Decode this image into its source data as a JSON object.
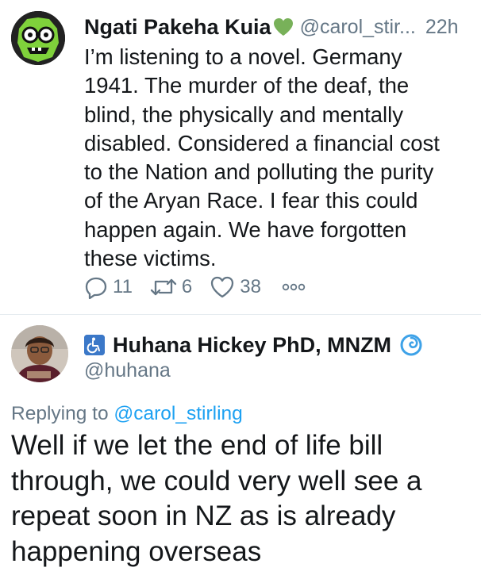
{
  "tweet": {
    "author_name": "Ngati Pakeha Kuia",
    "author_handle": "@carol_stir...",
    "time": "22h",
    "body_lines": [
      "I’m listening to a novel. Germany",
      "1941. The murder of the deaf, the",
      "blind, the physically and mentally",
      "disabled. Considered a financial cost",
      "to the Nation and polluting the purity",
      "of the Aryan Race. I fear this could",
      "happen again. We have forgotten",
      "these victims."
    ],
    "reply_count": "11",
    "retweet_count": "6",
    "like_count": "38",
    "icons": {
      "reply": "reply-icon",
      "retweet": "retweet-icon",
      "like": "like-icon",
      "more": "more-icon",
      "heart_emoji": "green-heart-emoji"
    }
  },
  "reply": {
    "author_name": "Huhana Hickey PhD, MNZM",
    "author_handle": "@huhana",
    "replying_to_label": "Replying to",
    "replying_to_handle": "@carol_stirling",
    "body_lines": [
      "Well if we let the end of life bill",
      "through, we could very well see a",
      "repeat soon in NZ as is already",
      "happening overseas"
    ],
    "icons": {
      "wheelchair": "wheelchair-emoji",
      "verified": "verified-badge-icon"
    }
  },
  "colors": {
    "text": "#14171a",
    "secondary": "#657786",
    "link": "#1da1f2",
    "heart": "#78b159",
    "wheelchair_bg": "#3b78c8"
  }
}
